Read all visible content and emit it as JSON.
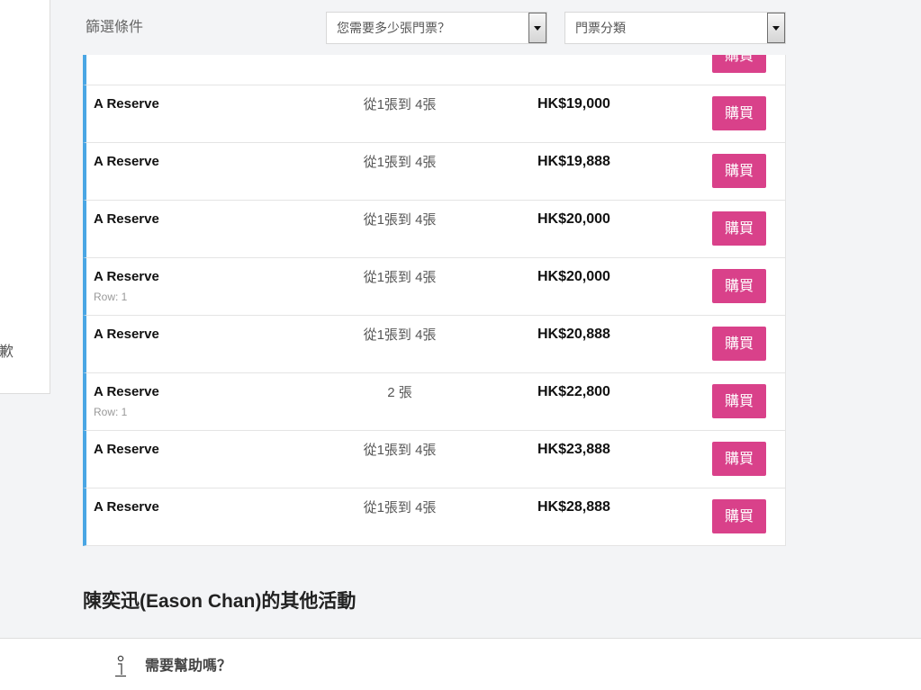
{
  "colors": {
    "accent_blue": "#4aa6e4",
    "buy_button": "#d9418a",
    "page_bg": "#f3f4f6"
  },
  "side_panel": {
    "text": "歉"
  },
  "filter_bar": {
    "label": "篩選條件",
    "quantity_select": {
      "value": "您需要多少張門票？",
      "icon": "chevron-down-icon"
    },
    "category_select": {
      "value": "門票分類",
      "icon": "chevron-down-icon"
    }
  },
  "listings": {
    "partial_row": {
      "buy_label": "購買"
    },
    "rows": [
      {
        "section": "A Reserve",
        "quantity": "從1張到 4張",
        "price": "HK$19,000",
        "buy_label": "購買"
      },
      {
        "section": "A Reserve",
        "quantity": "從1張到 4張",
        "price": "HK$19,888",
        "buy_label": "購買"
      },
      {
        "section": "A Reserve",
        "quantity": "從1張到 4張",
        "price": "HK$20,000",
        "buy_label": "購買"
      },
      {
        "section": "A Reserve",
        "row_note": "Row: 1",
        "quantity": "從1張到 4張",
        "price": "HK$20,000",
        "buy_label": "購買"
      },
      {
        "section": "A Reserve",
        "quantity": "從1張到 4張",
        "price": "HK$20,888",
        "buy_label": "購買"
      },
      {
        "section": "A Reserve",
        "row_note": "Row: 1",
        "quantity": "2 張",
        "price": "HK$22,800",
        "buy_label": "購買"
      },
      {
        "section": "A Reserve",
        "quantity": "從1張到 4張",
        "price": "HK$23,888",
        "buy_label": "購買"
      },
      {
        "section": "A Reserve",
        "quantity": "從1張到 4張",
        "price": "HK$28,888",
        "buy_label": "購買"
      }
    ]
  },
  "other_events": {
    "heading": "陳奕迅(Eason Chan)的其他活動"
  },
  "help": {
    "icon": "info-icon",
    "label": "需要幫助嗎？"
  }
}
